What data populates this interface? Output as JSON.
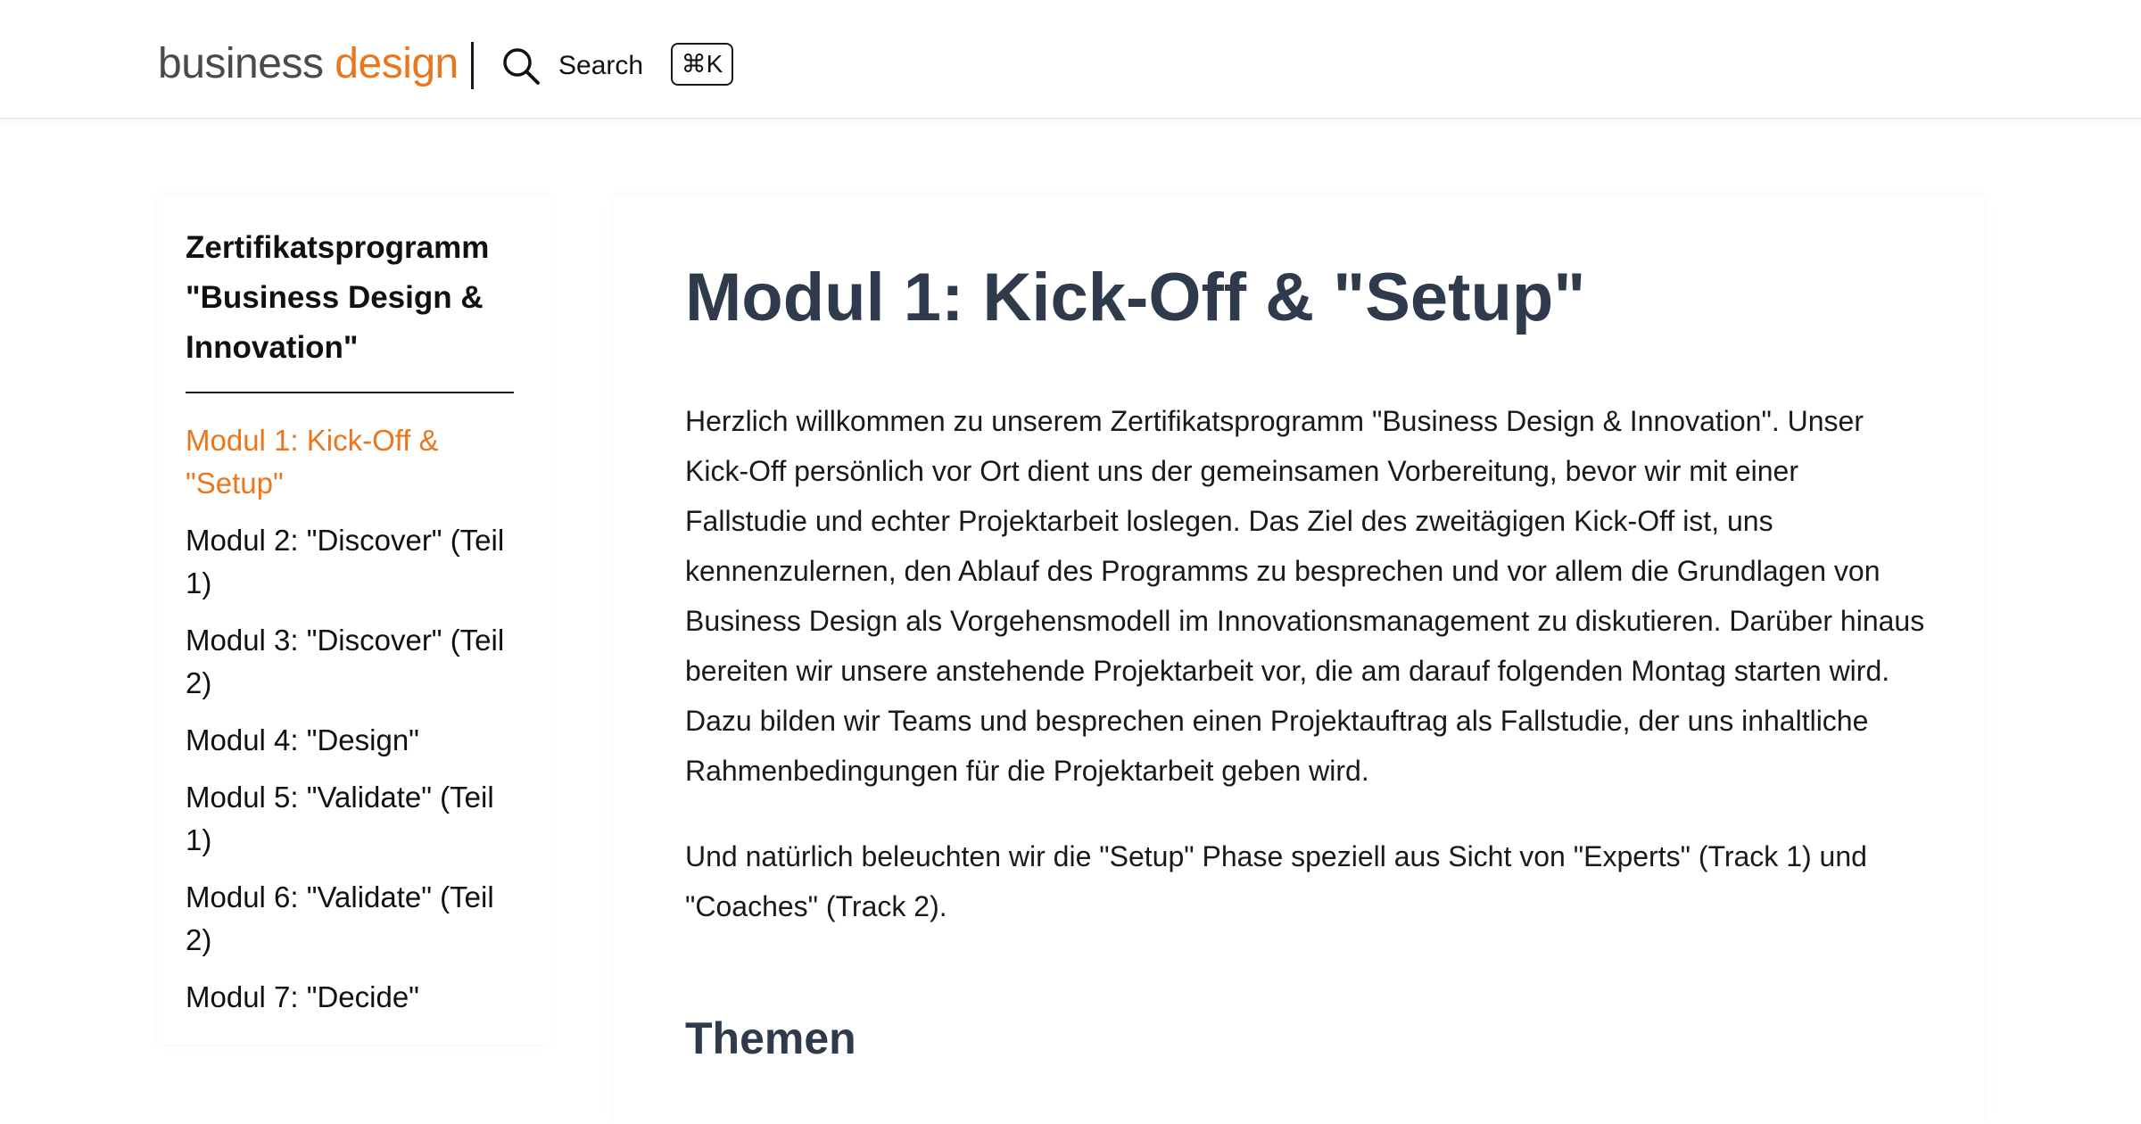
{
  "header": {
    "logo_word1": "business",
    "logo_word2": "design",
    "search_label": "Search",
    "search_shortcut": "⌘K"
  },
  "sidebar": {
    "title": "Zertifikatsprogramm \"Business Design & Innovation\"",
    "items": [
      {
        "label": "Modul 1: Kick-Off & \"Setup\"",
        "active": true
      },
      {
        "label": "Modul 2: \"Discover\" (Teil 1)",
        "active": false
      },
      {
        "label": "Modul 3: \"Discover\" (Teil 2)",
        "active": false
      },
      {
        "label": "Modul 4: \"Design\"",
        "active": false
      },
      {
        "label": "Modul 5: \"Validate\" (Teil 1)",
        "active": false
      },
      {
        "label": "Modul 6: \"Validate\" (Teil 2)",
        "active": false
      },
      {
        "label": "Modul 7: \"Decide\"",
        "active": false
      }
    ]
  },
  "main": {
    "title": "Modul 1: Kick-Off & \"Setup\"",
    "paragraphs": [
      "Herzlich willkommen zu unserem Zertifikatsprogramm \"Business Design & Innovation\". Unser Kick-Off persönlich vor Ort dient uns der gemeinsamen Vorbereitung, bevor wir mit einer Fallstudie und echter Projektarbeit loslegen. Das Ziel des zweitägigen Kick-Off ist, uns kennenzulernen, den Ablauf des Programms zu besprechen und vor allem die Grundlagen von Business Design als Vorgehensmodell im Innovationsmanagement zu diskutieren. Darüber hinaus bereiten wir unsere anstehende Projektarbeit vor, die am darauf folgenden Montag starten wird. Dazu bilden wir Teams und besprechen einen Projektauftrag als Fallstudie, der uns inhaltliche Rahmenbedingungen für die Projektarbeit geben wird.",
      "Und natürlich beleuchten wir die \"Setup\" Phase speziell aus Sicht von \"Experts\" (Track 1) und \"Coaches\" (Track 2)."
    ],
    "section_heading": "Themen"
  },
  "colors": {
    "accent": "#e8771d",
    "heading": "#2f3a4c",
    "text": "#1a1a1a",
    "logo_gray": "#4a4a4a"
  },
  "icons": {
    "search": "search-icon"
  }
}
